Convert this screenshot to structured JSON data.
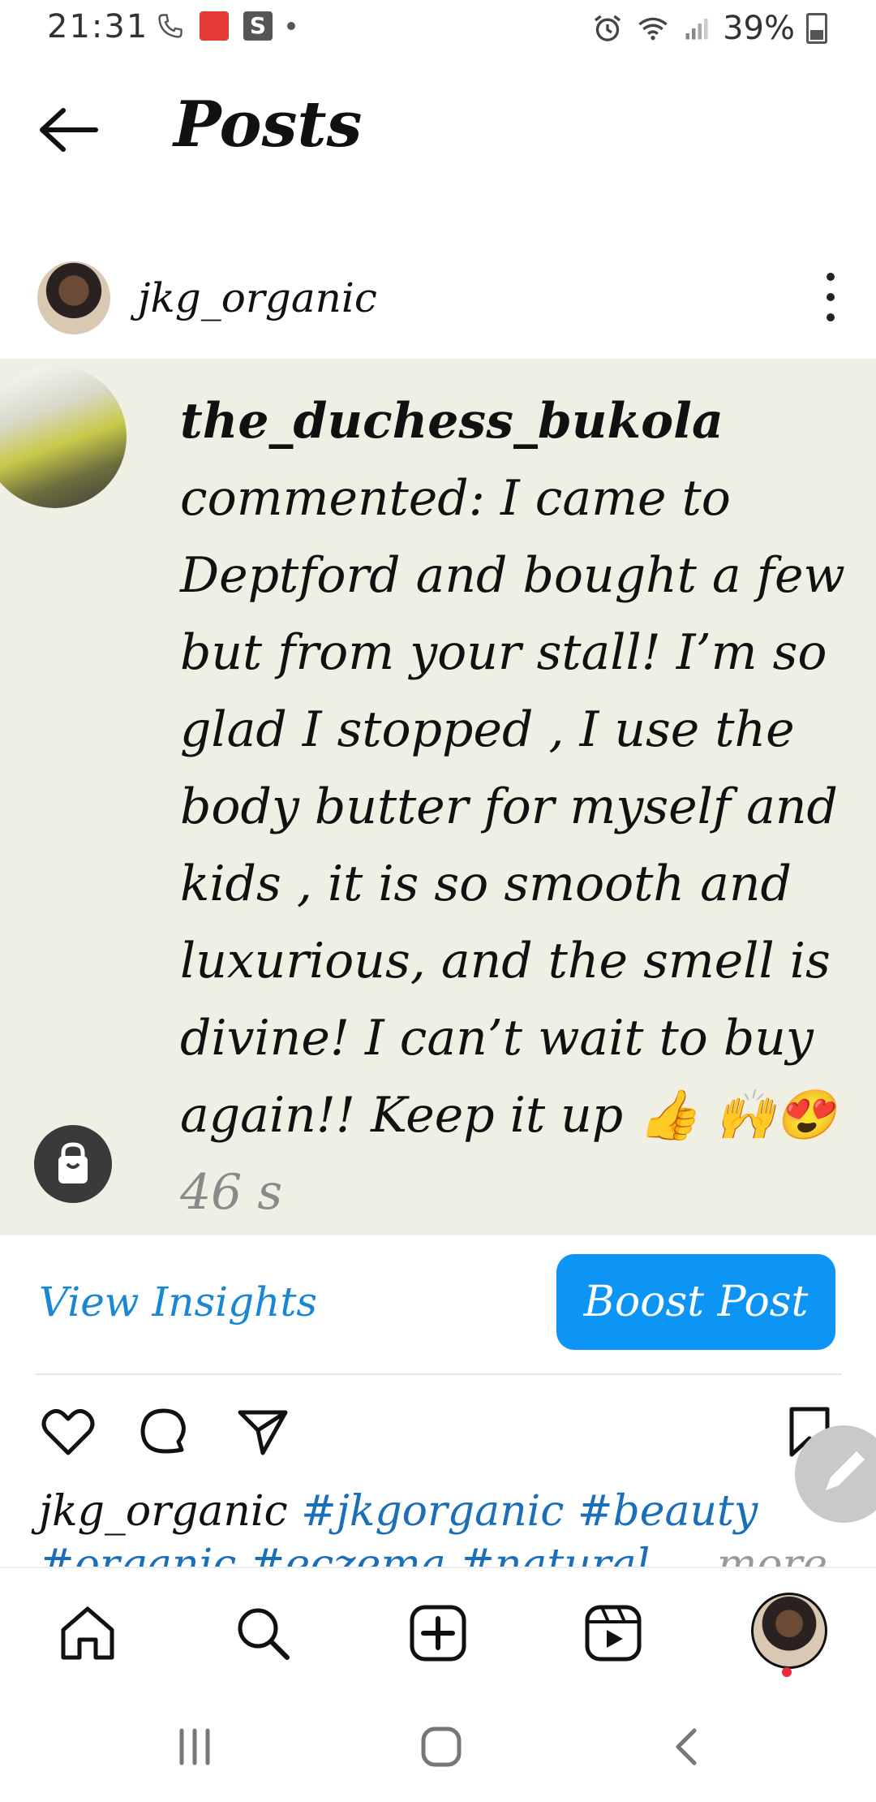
{
  "status_bar": {
    "time": "21:31",
    "battery": "39%",
    "app_badge": "S"
  },
  "header": {
    "title": "Posts"
  },
  "post": {
    "author": "jkg_organic",
    "image": {
      "commenter": "the_duchess_bukola",
      "comment": "commented: I came to Deptford and bought a few but from your stall! I’m so glad I stopped , I use the body butter for myself and kids , it is so smooth and luxurious, and the smell is divine! I can’t wait to buy again!! Keep it up 👍 🙌😍",
      "time": "46 s"
    },
    "insights_label": "View Insights",
    "boost_label": "Boost Post",
    "caption": {
      "user": "jkg_organic",
      "tags": "#jkgorganic #beauty",
      "line2": "#organic #eczema #natural",
      "more": "... more"
    }
  },
  "colors": {
    "accent": "#0d95f6",
    "link": "#1a87d4",
    "image_bg": "#efefe3"
  }
}
